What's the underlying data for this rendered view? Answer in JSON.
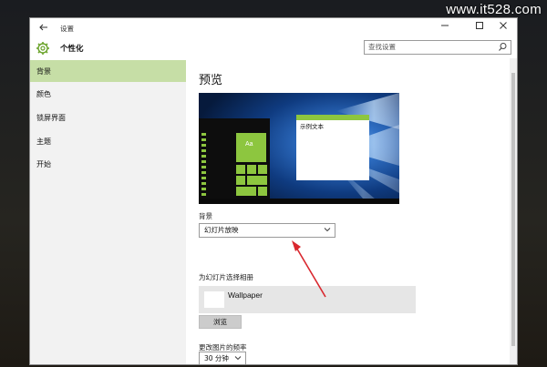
{
  "watermark": "www.it528.com",
  "window": {
    "title": "设置",
    "app_title": "个性化",
    "controls": {
      "minimize": "—",
      "maximize": "☐",
      "close": "✕"
    }
  },
  "search": {
    "placeholder": "查找设置"
  },
  "sidebar": {
    "items": [
      {
        "label": "背景",
        "active": true
      },
      {
        "label": "颜色"
      },
      {
        "label": "锁屏界面"
      },
      {
        "label": "主题"
      },
      {
        "label": "开始"
      }
    ]
  },
  "content": {
    "preview_heading": "预览",
    "preview_sample_text": "示例文本",
    "preview_tile_text": "Aa",
    "background_label": "背景",
    "background_value": "幻灯片放映",
    "album_label": "为幻灯片选择相册",
    "album_name": "Wallpaper",
    "browse_button": "浏览",
    "frequency_label": "更改图片的频率",
    "frequency_value": "30 分钟"
  },
  "colors": {
    "accent": "#8dc63f",
    "nav_active": "#c6dea6",
    "annotation_arrow": "#d9272e"
  }
}
